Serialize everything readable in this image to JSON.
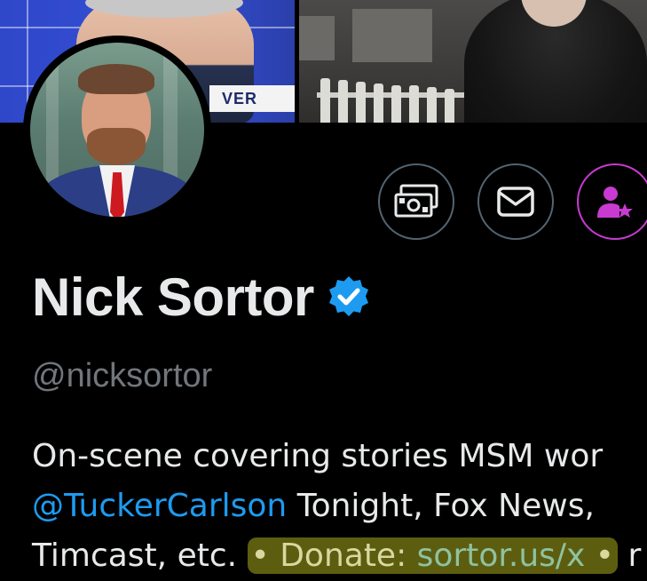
{
  "banner": {
    "left_image": {
      "description_tag": "banner-left-photo",
      "overlay_text": "VER"
    },
    "right_image": {
      "description_tag": "banner-right-photo"
    }
  },
  "profile": {
    "display_name": "Nick Sortor",
    "handle": "@nicksortor",
    "verified": true,
    "verified_color": "#1d9bf0",
    "avatar_alt": "Nick Sortor profile photo"
  },
  "actions": [
    {
      "name": "tip-button",
      "icon": "money-icon"
    },
    {
      "name": "message-button",
      "icon": "envelope-icon"
    },
    {
      "name": "subscribe-button",
      "icon": "person-star-icon",
      "accent": "#c93ad1"
    }
  ],
  "bio": {
    "line1": "On-scene covering stories MSM wor",
    "line2_mention": "@TuckerCarlson",
    "line2_rest": " Tonight, Fox News,",
    "line3_start": "Timcast, etc. ",
    "line3_highlight_prefix": "• Donate: ",
    "line3_link": "sortor.us/x",
    "line3_highlight_suffix": " •",
    "line3_trailing": " r"
  },
  "colors": {
    "background": "#000000",
    "text_primary": "#e7e9ea",
    "text_secondary": "#71767b",
    "link": "#1d9bf0",
    "highlight": "#aaaa1e"
  }
}
